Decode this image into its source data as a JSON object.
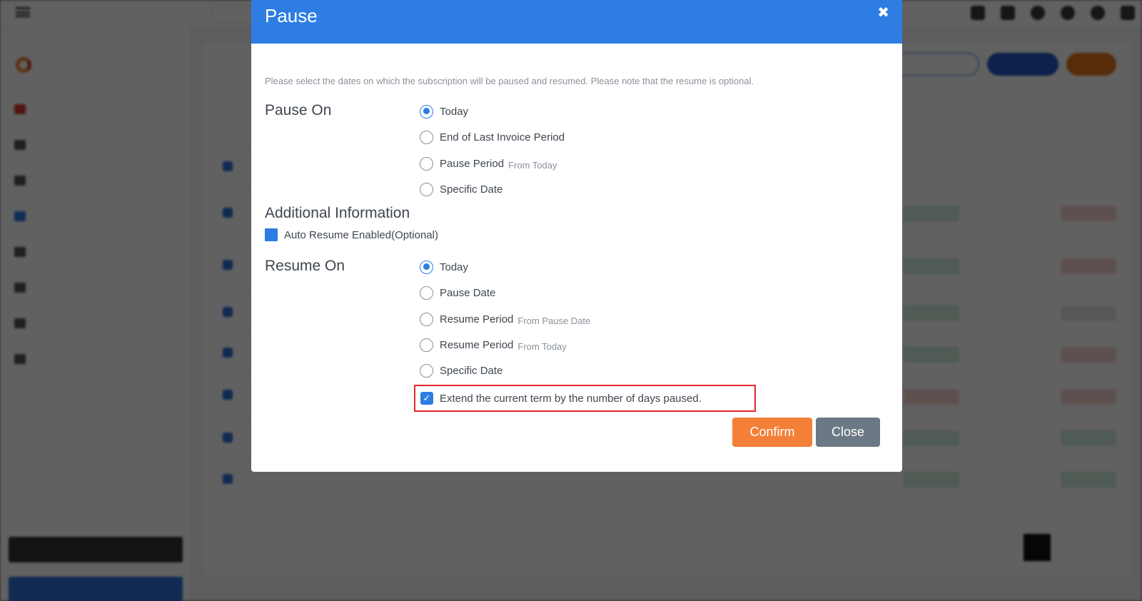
{
  "modal": {
    "title": "Pause",
    "close_icon": "close-icon",
    "intro": "Please select the dates on which the subscription will be paused and resumed. Please note that the resume is optional.",
    "pause_on": {
      "label": "Pause On",
      "options": [
        {
          "label": "Today",
          "sub": "",
          "selected": true
        },
        {
          "label": "End of Last Invoice Period",
          "sub": "",
          "selected": false
        },
        {
          "label": "Pause Period",
          "sub": "From Today",
          "selected": false
        },
        {
          "label": "Specific Date",
          "sub": "",
          "selected": false
        }
      ]
    },
    "additional": {
      "label": "Additional Information",
      "auto_resume_label": "Auto Resume Enabled(Optional)"
    },
    "resume_on": {
      "label": "Resume On",
      "options": [
        {
          "label": "Today",
          "sub": "",
          "selected": true
        },
        {
          "label": "Pause Date",
          "sub": "",
          "selected": false
        },
        {
          "label": "Resume Period",
          "sub": "From Pause Date",
          "selected": false
        },
        {
          "label": "Resume Period",
          "sub": "From Today",
          "selected": false
        },
        {
          "label": "Specific Date",
          "sub": "",
          "selected": false
        }
      ]
    },
    "extend_term": {
      "label": "Extend the current term by the number of days paused.",
      "checked": true
    },
    "buttons": {
      "confirm": "Confirm",
      "close": "Close"
    }
  },
  "colors": {
    "header": "#2d7de3",
    "confirm": "#f47f38",
    "close": "#6c7886",
    "highlight": "#e0262b"
  }
}
